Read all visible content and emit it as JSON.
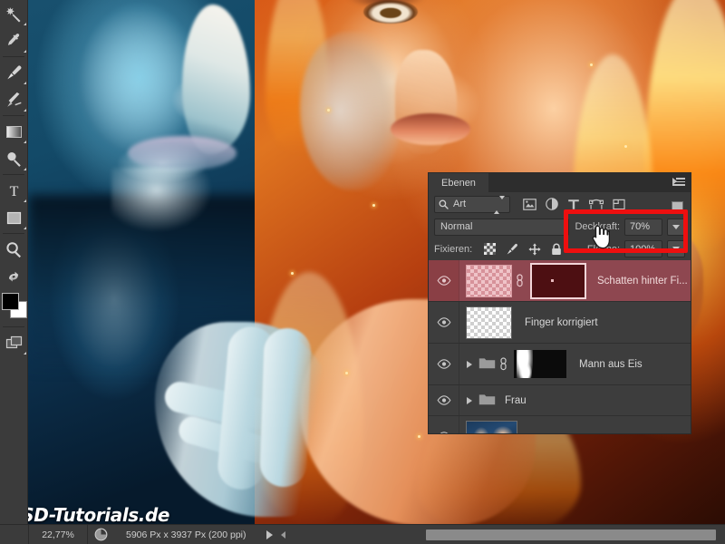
{
  "toolbar": {
    "tools": [
      {
        "name": "magic-wand-tool",
        "title": "Zauberstab"
      },
      {
        "name": "eyedropper-tool",
        "title": "Pipette"
      },
      {
        "name": "brush-tool",
        "title": "Pinsel"
      },
      {
        "name": "eraser-tool",
        "title": "Radiergummi"
      },
      {
        "name": "gradient-tool",
        "title": "Verlaufswerkzeug"
      },
      {
        "name": "dodge-tool",
        "title": "Abwedler"
      },
      {
        "name": "type-tool",
        "title": "Textwerkzeug"
      },
      {
        "name": "rectangle-tool",
        "title": "Rechteck"
      },
      {
        "name": "zoom-tool",
        "title": "Zoom"
      },
      {
        "name": "swap-colors-icon",
        "title": "Farben tauschen"
      }
    ],
    "foreground_color": "#000000",
    "background_color": "#ffffff",
    "screen_mode": "screen-mode-tool"
  },
  "canvas": {
    "watermark": "PSD-Tutorials.de"
  },
  "layers_panel": {
    "tab_label": "Ebenen",
    "menu_icon": "panel-menu-icon",
    "filter": {
      "kind_label": "Art",
      "search_icon": "search-icon",
      "icons": [
        {
          "name": "filter-pixel-icon",
          "title": "Pixelebenen"
        },
        {
          "name": "filter-adjustment-icon",
          "title": "Einstellungsebenen"
        },
        {
          "name": "filter-type-icon",
          "title": "Textebenen"
        },
        {
          "name": "filter-shape-icon",
          "title": "Formebenen"
        },
        {
          "name": "filter-smartobject-icon",
          "title": "Smartobjekte"
        }
      ],
      "toggle_name": "filter-enable-toggle"
    },
    "blend_mode": "Normal",
    "opacity_label": "Deckkraft:",
    "opacity_value": "70%",
    "lock_label": "Fixieren:",
    "lock_icons": [
      {
        "name": "lock-transparency-icon",
        "title": "Transparente Pixel fixieren"
      },
      {
        "name": "lock-pixels-icon",
        "title": "Bildpixel fixieren"
      },
      {
        "name": "lock-position-icon",
        "title": "Position fixieren"
      },
      {
        "name": "lock-all-icon",
        "title": "Alles fixieren"
      }
    ],
    "fill_label": "Fläche:",
    "fill_value": "100%",
    "layers": [
      {
        "name": "Schatten hinter Fi...",
        "selected": true,
        "visible": true,
        "type": "pixel-with-mask",
        "has_link": true,
        "mask_color": "#4d0f12"
      },
      {
        "name": "Finger korrigiert",
        "selected": false,
        "visible": true,
        "type": "pixel",
        "has_link": false
      },
      {
        "name": "Mann aus Eis",
        "selected": false,
        "visible": true,
        "type": "group-with-mask",
        "has_link": true
      },
      {
        "name": "Frau",
        "selected": false,
        "visible": true,
        "type": "group",
        "has_link": false
      },
      {
        "name": "",
        "selected": false,
        "visible": true,
        "type": "photo",
        "has_link": false
      }
    ]
  },
  "annotation": {
    "name": "opacity-highlight-rectangle",
    "color": "#ee0f0f"
  },
  "cursor": {
    "name": "hand-pointer-cursor"
  },
  "statusbar": {
    "zoom": "22,77%",
    "doc_icon": "document-size-icon",
    "doc_size": "5906 Px x 3937 Px (200 ppi)",
    "play_arrow": "play-arrow-icon",
    "prev_arrow": "prev-arrow-icon"
  }
}
